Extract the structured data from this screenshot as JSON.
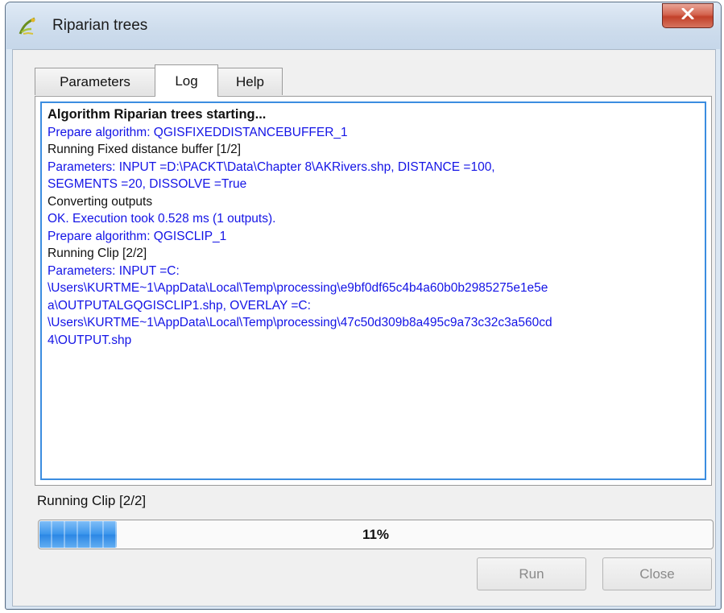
{
  "window": {
    "title": "Riparian trees"
  },
  "tabs": [
    {
      "label": "Parameters",
      "active": false
    },
    {
      "label": "Log",
      "active": true
    },
    {
      "label": "Help",
      "active": false
    }
  ],
  "log": [
    {
      "text": "Algorithm Riparian trees starting...",
      "style": "bold"
    },
    {
      "text": "Prepare algorithm: QGISFIXEDDISTANCEBUFFER_1",
      "style": "blue"
    },
    {
      "text": "Running Fixed distance buffer [1/2]",
      "style": "black"
    },
    {
      "text": "Parameters: INPUT =D:\\PACKT\\Data\\Chapter 8\\AKRivers.shp, DISTANCE =100,",
      "style": "blue"
    },
    {
      "text": "SEGMENTS =20, DISSOLVE =True",
      "style": "blue"
    },
    {
      "text": "Converting outputs",
      "style": "black"
    },
    {
      "text": "OK. Execution took 0.528 ms (1 outputs).",
      "style": "blue"
    },
    {
      "text": "Prepare algorithm: QGISCLIP_1",
      "style": "blue"
    },
    {
      "text": "Running Clip [2/2]",
      "style": "black"
    },
    {
      "text": "Parameters: INPUT =C:",
      "style": "blue"
    },
    {
      "text": "\\Users\\KURTME~1\\AppData\\Local\\Temp\\processing\\e9bf0df65c4b4a60b0b2985275e1e5e",
      "style": "blue"
    },
    {
      "text": "a\\OUTPUTALGQGISCLIP1.shp, OVERLAY =C:",
      "style": "blue"
    },
    {
      "text": "\\Users\\KURTME~1\\AppData\\Local\\Temp\\processing\\47c50d309b8a495c9a73c32c3a560cd",
      "style": "blue"
    },
    {
      "text": "4\\OUTPUT.shp",
      "style": "blue"
    }
  ],
  "status": {
    "text": "Running Clip [2/2]"
  },
  "progress": {
    "value": 0.115,
    "label": "11%"
  },
  "buttons": {
    "run": "Run",
    "close": "Close"
  },
  "colors": {
    "log_blue": "#1414e6",
    "progress_blue": "#3a95ec",
    "close_red": "#c2412a"
  },
  "icons": {
    "app": "qgis-processing-icon",
    "close": "close-icon"
  }
}
